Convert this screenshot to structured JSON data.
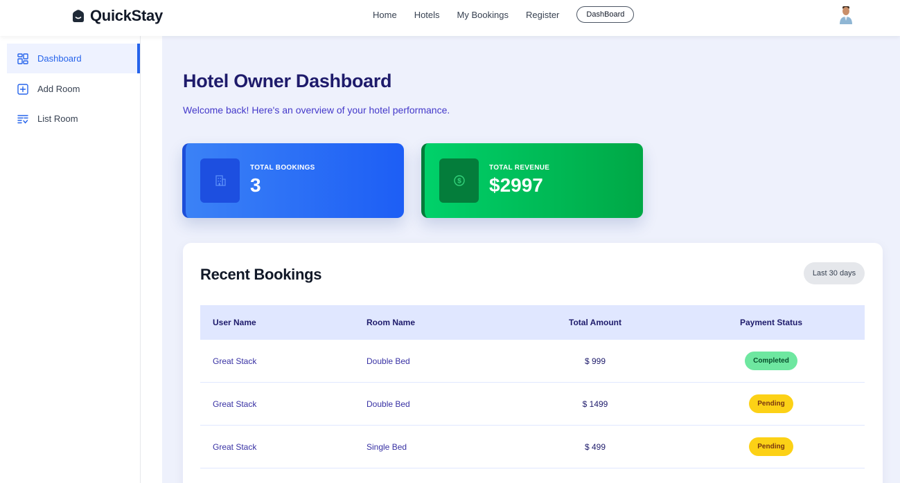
{
  "header": {
    "logo_text": "QuickStay",
    "nav": [
      "Home",
      "Hotels",
      "My Bookings",
      "Register"
    ],
    "dashboard_button": "DashBoard"
  },
  "sidebar": {
    "items": [
      {
        "label": "Dashboard",
        "icon": "dashboard-grid-icon",
        "active": true
      },
      {
        "label": "Add Room",
        "icon": "add-square-icon",
        "active": false
      },
      {
        "label": "List Room",
        "icon": "list-icon",
        "active": false
      }
    ]
  },
  "main": {
    "title": "Hotel Owner Dashboard",
    "subtitle": "Welcome back! Here's an overview of your hotel performance.",
    "stats": [
      {
        "label": "TOTAL BOOKINGS",
        "value": "3",
        "icon": "building-icon",
        "color": "#2563eb"
      },
      {
        "label": "TOTAL REVENUE",
        "value": "$2997",
        "icon": "dollar-circle-icon",
        "color": "#00b853"
      }
    ],
    "bookings": {
      "title": "Recent Bookings",
      "range": "Last 30 days",
      "columns": [
        "User Name",
        "Room Name",
        "Total Amount",
        "Payment Status"
      ],
      "rows": [
        {
          "user": "Great Stack",
          "room": "Double Bed",
          "amount": "$ 999",
          "status": "Completed"
        },
        {
          "user": "Great Stack",
          "room": "Double Bed",
          "amount": "$ 1499",
          "status": "Pending"
        },
        {
          "user": "Great Stack",
          "room": "Single Bed",
          "amount": "$ 499",
          "status": "Pending"
        }
      ]
    }
  },
  "colors": {
    "accent": "#2563eb",
    "title": "#1e1b6b",
    "completed": "#6ee7a0",
    "pending": "#fcd116"
  }
}
